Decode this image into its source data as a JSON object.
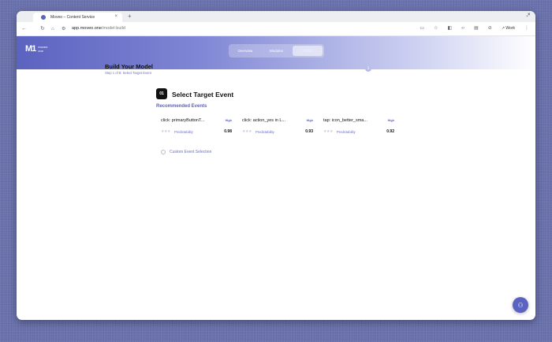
{
  "browser": {
    "tab_title": "Moveo – Content Service",
    "tab_close": "×",
    "new_tab": "+",
    "url_domain": "app.moveo.one",
    "url_path": "/model-build",
    "profile_label": "Work"
  },
  "header": {
    "logo_mark": "M1",
    "logo_text_1": "moveo",
    "logo_text_2": "one",
    "segments": [
      "Overview",
      "Modules",
      "Models"
    ],
    "active_segment": "Models"
  },
  "page": {
    "title": "Build Your Model",
    "subtitle": "Step 1 of 8: Select Target Event",
    "step_number": "1"
  },
  "section": {
    "badge": "01",
    "title": "Select Target Event",
    "recommended_title": "Recommended Events",
    "events": [
      {
        "name": "click: primaryButtonT...",
        "level": "High",
        "metric": "Predictability",
        "score": "0.98"
      },
      {
        "name": "click: action_yes in L...",
        "level": "High",
        "metric": "Predictability",
        "score": "0.93"
      },
      {
        "name": "tap: icon_better_sma...",
        "level": "High",
        "metric": "Predictability",
        "score": "0.92"
      }
    ],
    "custom_label": "Custom Event Selection"
  },
  "colors": {
    "accent": "#5b63c0",
    "accent_light": "#6a71c6"
  }
}
